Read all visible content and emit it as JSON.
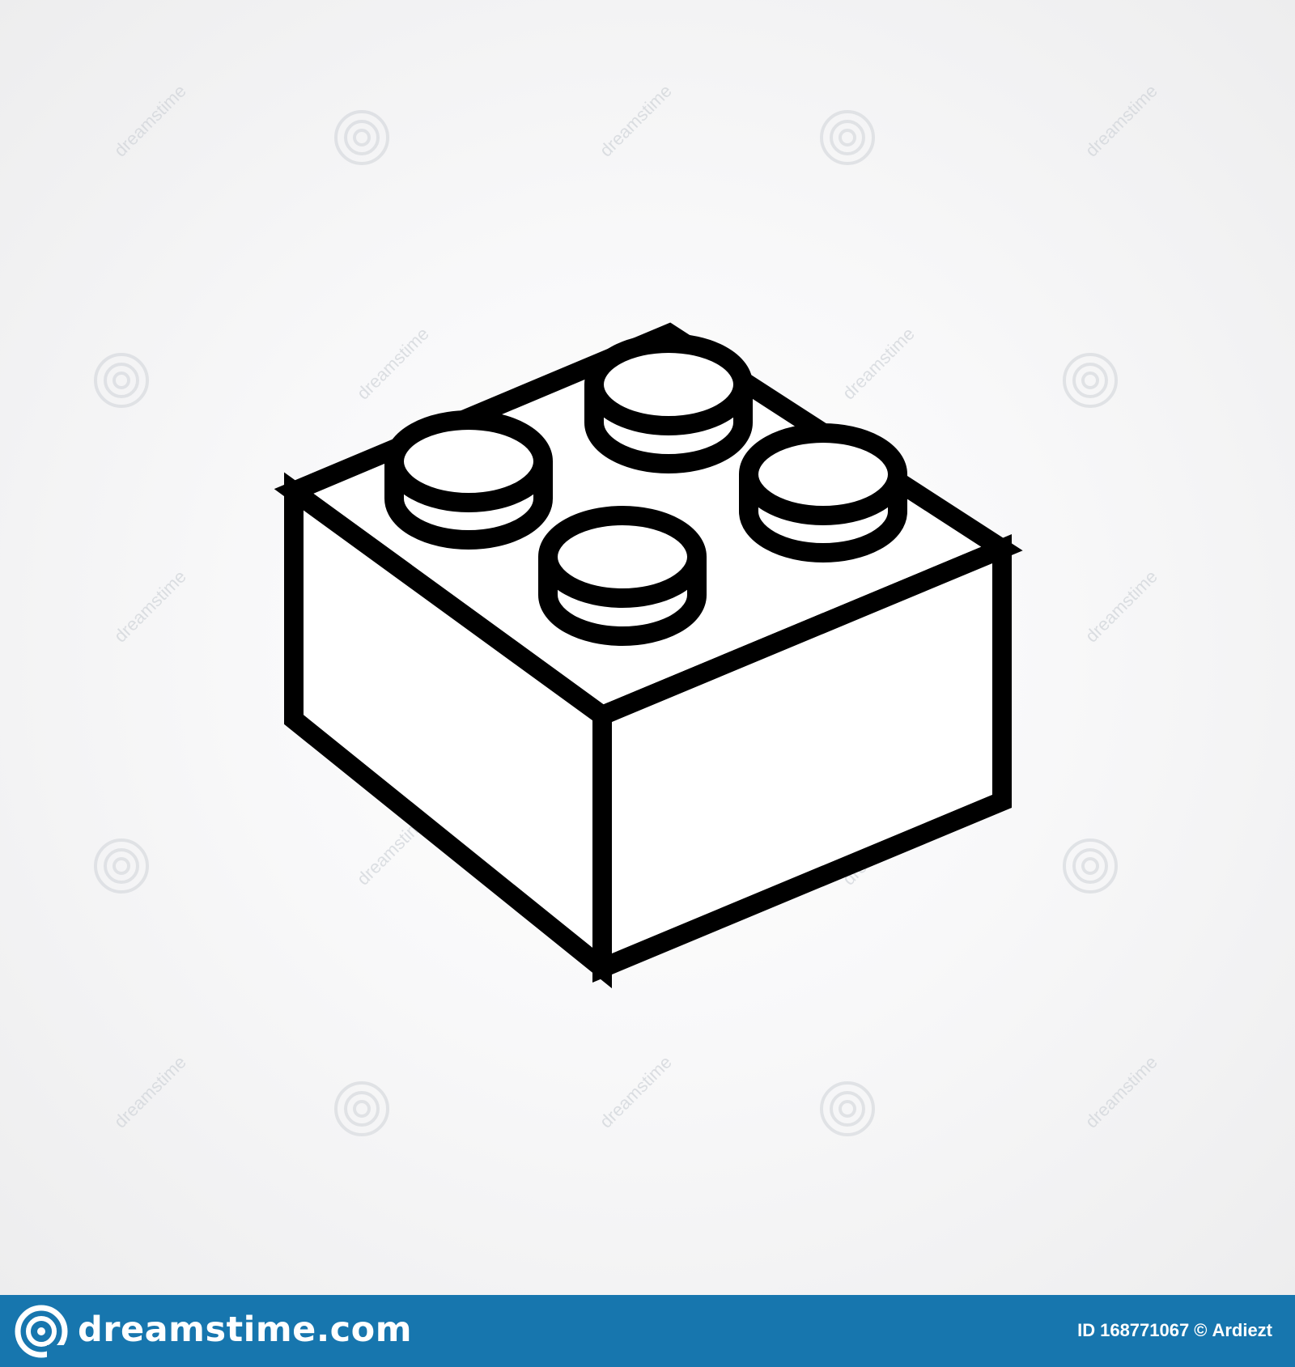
{
  "illustration": {
    "subject": "brick-outline-icon",
    "stroke_color": "#000000",
    "fill_color": "#ffffff"
  },
  "watermark": {
    "text": "dreamstime",
    "color": "#cfd3d8"
  },
  "footer": {
    "background_color": "#1776ae",
    "logo_icon": "dreamstime-spiral-logo",
    "logo_text": "dreamstime.com",
    "id_label": "ID",
    "id_value": "168771067",
    "copyright_symbol": "©",
    "author": "Ardiezt"
  }
}
